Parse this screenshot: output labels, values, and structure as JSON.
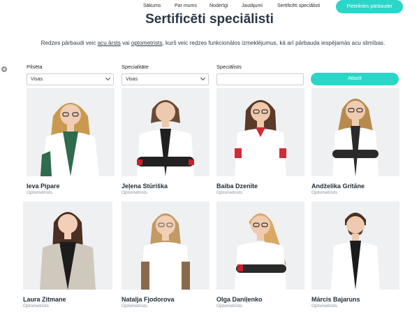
{
  "nav": {
    "items": [
      "Sākums",
      "Par mums",
      "Noderīgi",
      "Jautājumi",
      "Sertificēti speciālisti"
    ],
    "cta_label": "Pieteikties pārbaudei"
  },
  "page_title": "Sertificēti speciālisti",
  "intro": {
    "part1": "Redzes pārbaudi veic ",
    "link1": "acu ārsts",
    "part2": " vai ",
    "link2": "optometrists",
    "part3": ", kurš veic redzes funkcionālos izmeklējumus, kā arī pārbauda iespējamās acu slimības."
  },
  "filters": {
    "city": {
      "label": "Pilsēta",
      "value": "Visas"
    },
    "specialty": {
      "label": "Specialitāte",
      "value": "Visas"
    },
    "specialist": {
      "label": "Speciālists",
      "value": ""
    },
    "search_label": "Atlasīt"
  },
  "specialists": [
    {
      "name": "Ieva Pipare",
      "role": "Optometrists"
    },
    {
      "name": "Jeļena Stūriška",
      "role": "Optometrists"
    },
    {
      "name": "Baiba Dzenīte",
      "role": "Optometrists"
    },
    {
      "name": "Andželika Gritāne",
      "role": "Optometrists"
    },
    {
      "name": "Laura Zitmane",
      "role": "Optometrists"
    },
    {
      "name": "Natalja Fjodorova",
      "role": "Optometrists"
    },
    {
      "name": "Olga Daniļenko",
      "role": "Optometrists"
    },
    {
      "name": "Mārcis Bajaruns",
      "role": "Optometrists"
    }
  ],
  "colors": {
    "accent": "#2bd6c9",
    "text": "#1f2a37",
    "muted": "#8a9199"
  }
}
